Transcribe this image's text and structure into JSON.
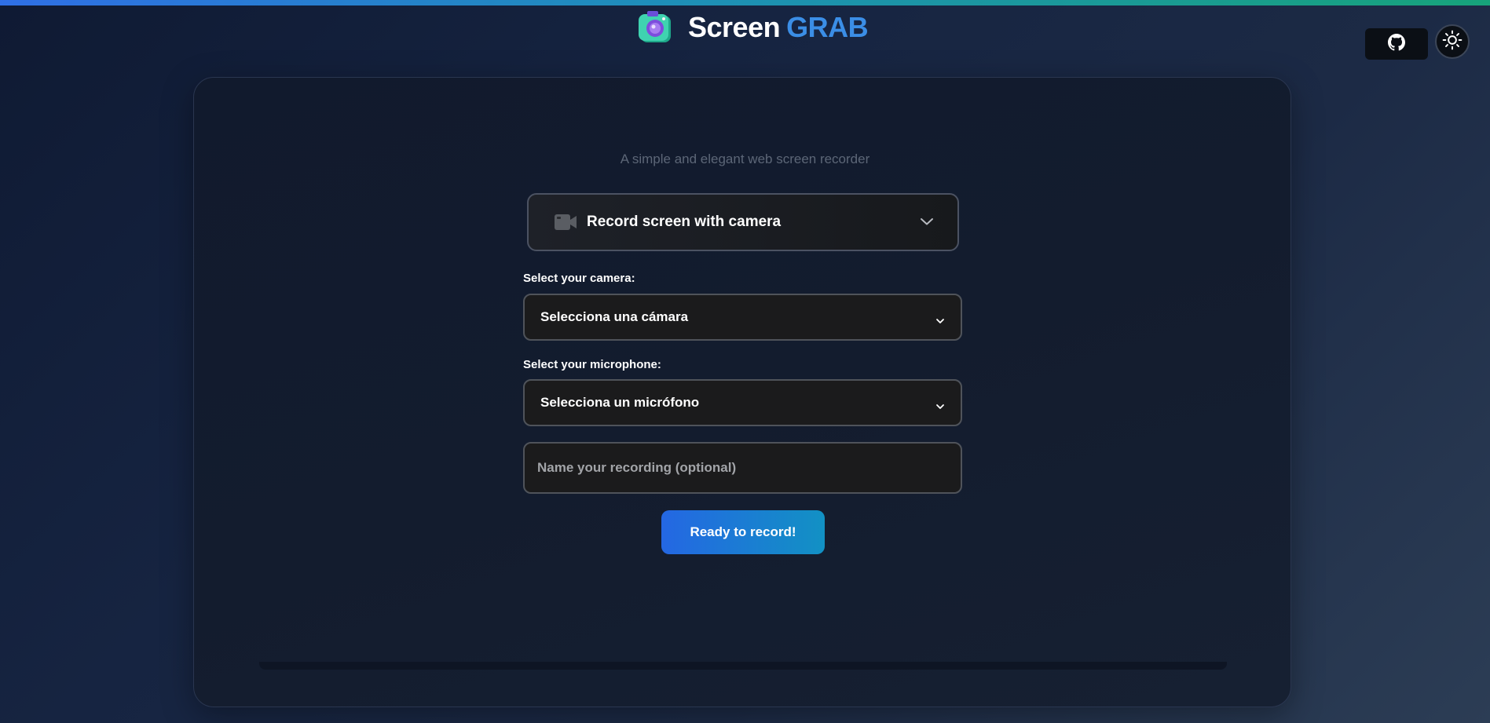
{
  "header": {
    "logo_word1": "Screen",
    "logo_word2": "GRAB",
    "logo_icon": "camera-logo-icon",
    "github_icon": "github-icon",
    "theme_icon": "sun-icon"
  },
  "main": {
    "subtitle": "A simple and elegant web screen recorder",
    "mode_select": {
      "icon": "video-camera-icon",
      "value": "Record screen with camera"
    },
    "camera": {
      "label": "Select your camera:",
      "value": "Selecciona una cámara"
    },
    "microphone": {
      "label": "Select your microphone:",
      "value": "Selecciona un micrófono"
    },
    "recording_name": {
      "value": "",
      "placeholder": "Name your recording (optional)"
    },
    "record_button": "Ready to record!"
  },
  "colors": {
    "accent_blue": "#2467e3",
    "accent_cyan": "#1291c4",
    "brand_grab": "#3b8ee6",
    "top_bar_start": "#2f6fe6",
    "top_bar_end": "#17a37a"
  }
}
